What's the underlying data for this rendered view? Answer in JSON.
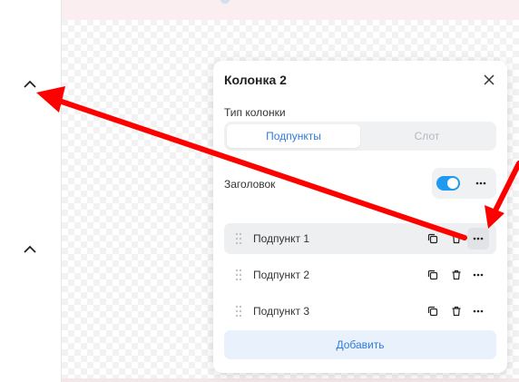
{
  "panel": {
    "title": "Колонка 2",
    "column_type_label": "Тип колонки",
    "column_type_options": [
      "Подпункты",
      "Слот"
    ],
    "column_type_selected": "Подпункты",
    "header_label": "Заголовок",
    "header_enabled": true,
    "items": [
      {
        "label": "Подпункт 1"
      },
      {
        "label": "Подпункт 2"
      },
      {
        "label": "Подпункт 3"
      }
    ],
    "add_label": "Добавить"
  },
  "colors": {
    "accent": "#2f7bd9",
    "toggle_on": "#1e9bf0",
    "annotation_arrow": "#ff0000"
  },
  "icons": {
    "left_strip": [
      "chevron-up-icon",
      "chevron-up-icon"
    ],
    "row_actions": [
      "copy-icon",
      "trash-icon",
      "more-icon"
    ],
    "close": "close-icon",
    "drag": "drag-handle-icon"
  }
}
